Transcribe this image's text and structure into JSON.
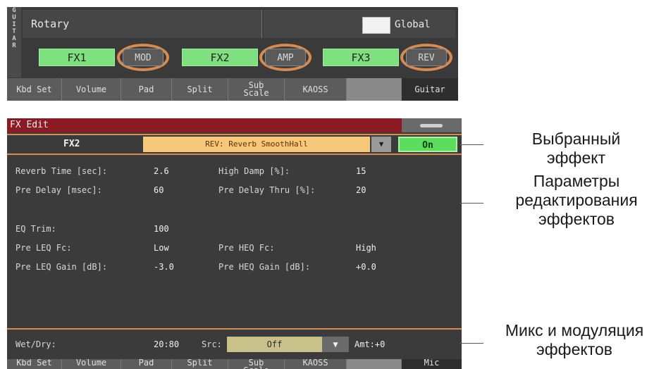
{
  "top_panel": {
    "side_label": [
      "G",
      "U",
      "I",
      "T",
      "A",
      "R"
    ],
    "effect_name": "Rotary",
    "global_label": "Global",
    "fx_slots": [
      {
        "fx": "FX1",
        "type": "MOD"
      },
      {
        "fx": "FX2",
        "type": "AMP"
      },
      {
        "fx": "FX3",
        "type": "REV"
      }
    ],
    "tabs": [
      "Kbd Set",
      "Volume",
      "Pad",
      "Split",
      "Sub\nScale",
      "KAOSS",
      "",
      "Guitar"
    ]
  },
  "fx_edit": {
    "title": "FX Edit",
    "fx_name": "FX2",
    "fx_type": "REV: Reverb SmoothHall",
    "on_label": "On",
    "params": [
      {
        "label": "Reverb Time [sec]:",
        "value": "2.6"
      },
      {
        "label": "High Damp [%]:",
        "value": "15"
      },
      {
        "label": "Pre Delay [msec]:",
        "value": "60"
      },
      {
        "label": "Pre Delay Thru [%]:",
        "value": "20"
      },
      {
        "label": "EQ Trim:",
        "value": "100"
      },
      {
        "label": "Pre LEQ Fc:",
        "value": "Low"
      },
      {
        "label": "Pre HEQ Fc:",
        "value": "High"
      },
      {
        "label": "Pre LEQ Gain [dB]:",
        "value": "-3.0"
      },
      {
        "label": "Pre HEQ Gain [dB]:",
        "value": "+0.0"
      }
    ],
    "mix": {
      "label": "Wet/Dry:",
      "value": "20:80",
      "src_label": "Src:",
      "src_value": "Off",
      "amt": "Amt:+0"
    },
    "tabs": [
      "Kbd Set",
      "Volume",
      "Pad",
      "Split",
      "Sub\nScale",
      "KAOSS",
      "",
      "Mic"
    ]
  },
  "annotations": {
    "selected_effect": [
      "Выбранный",
      "эффект"
    ],
    "edit_params": [
      "Параметры",
      "редактирования",
      "эффектов"
    ],
    "mix_mod": [
      "Микс и модуляция",
      "эффектов"
    ]
  },
  "colors": {
    "panel_bg": "#3a3a3a",
    "fx_green": "#7fe07f",
    "ring_orange": "#d98a4f",
    "title_red": "#8b1a22",
    "type_yellow": "#f6c97a"
  }
}
